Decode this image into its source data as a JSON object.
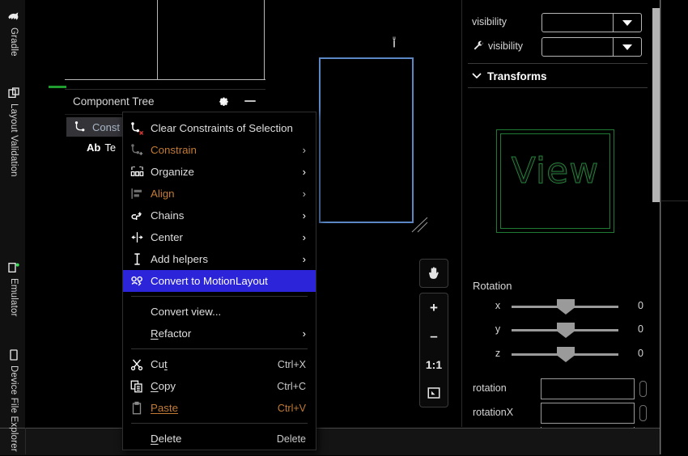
{
  "window": {
    "left_panel": {
      "component_tree": {
        "title": "Component Tree",
        "gear_icon": "gear-icon",
        "minimize_icon": "minimize-icon",
        "items": [
          {
            "label": "Const",
            "icon": "constraint-layout-icon",
            "selected": true
          },
          {
            "label": "Te",
            "icon": "text-view-icon",
            "prefix": "Ab",
            "selected": false
          }
        ]
      }
    },
    "canvas": {
      "wrench_icon": "wrench-icon",
      "resize_handle_icon": "resize-handle-icon",
      "device_frame_border_color": "#5b87c4",
      "toolbar": {
        "pan_label": "pan-tool",
        "zoom_in_label": "+",
        "zoom_out_label": "–",
        "actual_size_label": "1:1",
        "zoom_to_fit_label": "zoom-to-fit"
      }
    },
    "attributes_panel": {
      "rows": [
        {
          "label": "visibility",
          "value": "",
          "icon": null
        },
        {
          "label": "visibility",
          "value": "",
          "icon": "wrench-icon"
        }
      ],
      "transforms": {
        "label": "Transforms",
        "expanded": true,
        "chevron_icon": "chevron-down-icon",
        "preview_text": "View",
        "preview_color": "#25833a",
        "rotation": {
          "title": "Rotation",
          "sliders": [
            {
              "axis": "x",
              "value": "0"
            },
            {
              "axis": "y",
              "value": "0"
            },
            {
              "axis": "z",
              "value": "0"
            }
          ],
          "fields": [
            {
              "label": "rotation",
              "value": ""
            },
            {
              "label": "rotationX",
              "value": ""
            }
          ]
        }
      }
    },
    "right_rail": {
      "tabs": [
        {
          "label": "Gradle",
          "icon": "gradle-elephant-icon"
        },
        {
          "label": "Layout Validation",
          "icon": "layout-validation-icon"
        },
        {
          "label": "Emulator",
          "icon": "emulator-icon"
        },
        {
          "label": "Device File Explorer",
          "icon": "device-file-explorer-icon"
        }
      ]
    },
    "context_menu": {
      "groups": [
        {
          "items": [
            {
              "label": "Clear Constraints of Selection",
              "icon": "clear-constraints-icon",
              "dimmed": false,
              "submenu": false,
              "shortcut": "",
              "selected": false
            },
            {
              "label": "Constrain",
              "icon": "constrain-icon",
              "dimmed": true,
              "submenu": true,
              "shortcut": "",
              "selected": false
            },
            {
              "label": "Organize",
              "icon": "organize-icon",
              "dimmed": false,
              "submenu": true,
              "shortcut": "",
              "selected": false
            },
            {
              "label": "Align",
              "icon": "align-icon",
              "dimmed": true,
              "submenu": true,
              "shortcut": "",
              "selected": false
            },
            {
              "label": "Chains",
              "icon": "chains-icon",
              "dimmed": false,
              "submenu": true,
              "shortcut": "",
              "selected": false
            },
            {
              "label": "Center",
              "icon": "center-icon",
              "dimmed": false,
              "submenu": true,
              "shortcut": "",
              "selected": false
            },
            {
              "label": "Add helpers",
              "icon": "add-helpers-icon",
              "dimmed": false,
              "submenu": true,
              "shortcut": "",
              "selected": false
            },
            {
              "label": "Convert to MotionLayout",
              "icon": "motion-layout-icon",
              "dimmed": false,
              "submenu": false,
              "shortcut": "",
              "selected": true
            }
          ]
        },
        {
          "items": [
            {
              "label": "Convert view...",
              "icon": null,
              "dimmed": false,
              "submenu": false,
              "shortcut": "",
              "selected": false
            },
            {
              "label": "Refactor",
              "icon": null,
              "dimmed": false,
              "submenu": true,
              "shortcut": "",
              "selected": false,
              "mnemonic": "R"
            }
          ]
        },
        {
          "items": [
            {
              "label": "Cut",
              "icon": "cut-icon",
              "dimmed": false,
              "submenu": false,
              "shortcut": "Ctrl+X",
              "selected": false,
              "mnemonic": "t"
            },
            {
              "label": "Copy",
              "icon": "copy-icon",
              "dimmed": false,
              "submenu": false,
              "shortcut": "Ctrl+C",
              "selected": false,
              "mnemonic": "C"
            },
            {
              "label": "Paste",
              "icon": "paste-icon",
              "dimmed": true,
              "submenu": false,
              "shortcut": "Ctrl+V",
              "selected": false,
              "mnemonic": "P"
            }
          ]
        },
        {
          "items": [
            {
              "label": "Delete",
              "icon": null,
              "dimmed": false,
              "submenu": false,
              "shortcut": "Delete",
              "selected": false,
              "mnemonic": "D"
            }
          ]
        }
      ],
      "highlight_color": "#2b24d8",
      "dim_color": "#c37b34"
    }
  }
}
